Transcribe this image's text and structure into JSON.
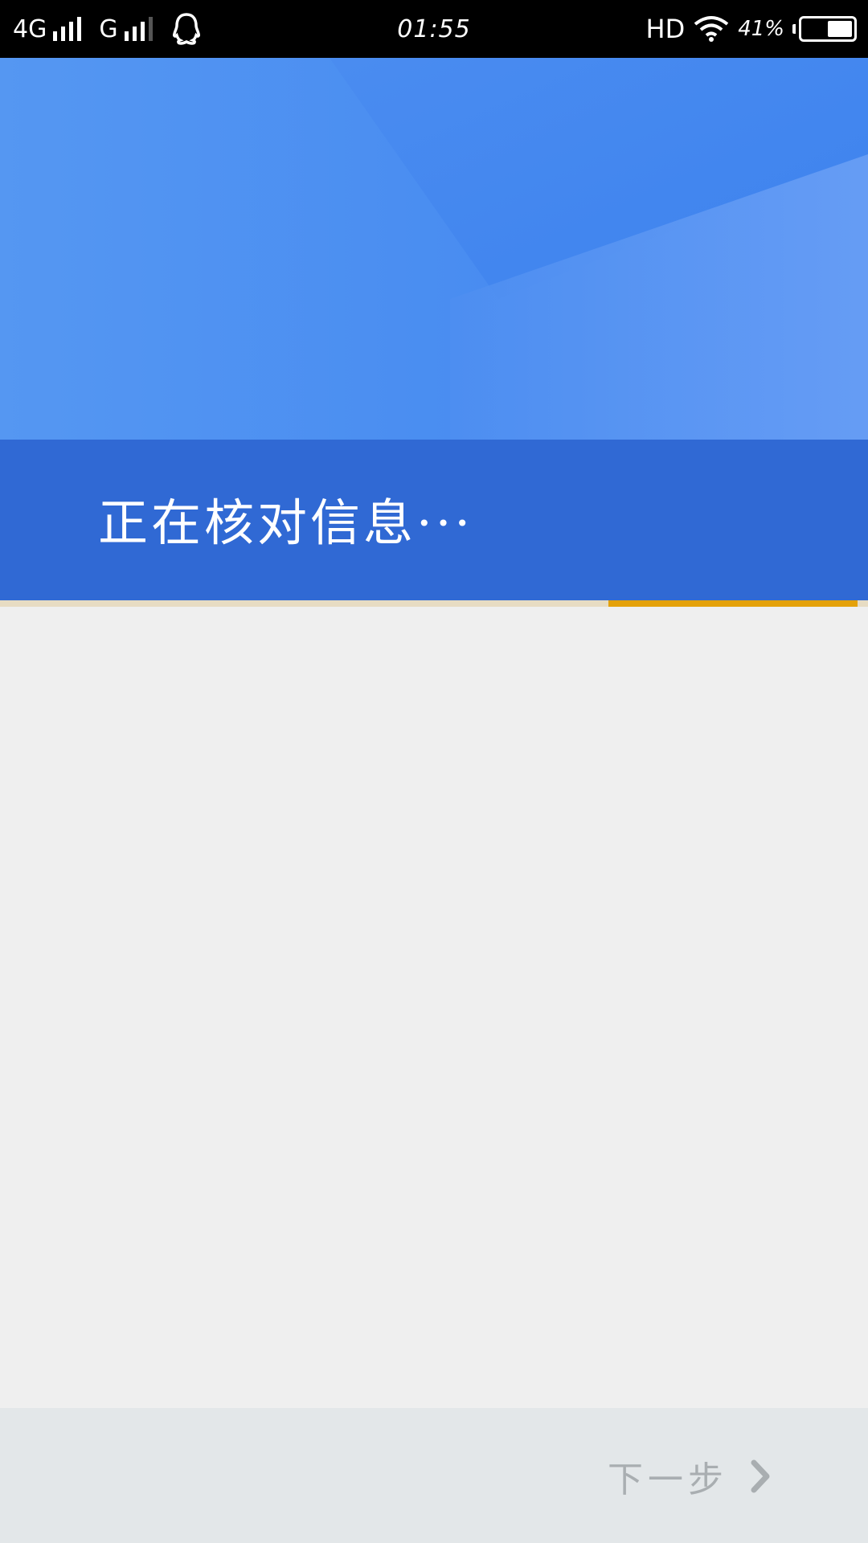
{
  "status_bar": {
    "network_1": "4G",
    "network_2": "G",
    "time": "01:55",
    "hd": "HD",
    "battery_percent": "41%",
    "icons": [
      "signal-icon",
      "signal-icon",
      "qq-icon",
      "wifi-icon",
      "battery-icon"
    ]
  },
  "banner": {
    "title": "正在核对信息···",
    "colors": {
      "sky": "#4a8cf0",
      "strip": "#3069d4",
      "progress": "#e4a10a"
    }
  },
  "progress": {
    "value": 0.3
  },
  "footer": {
    "next_label": "下一步",
    "next_icon": "chevron-right-icon"
  }
}
